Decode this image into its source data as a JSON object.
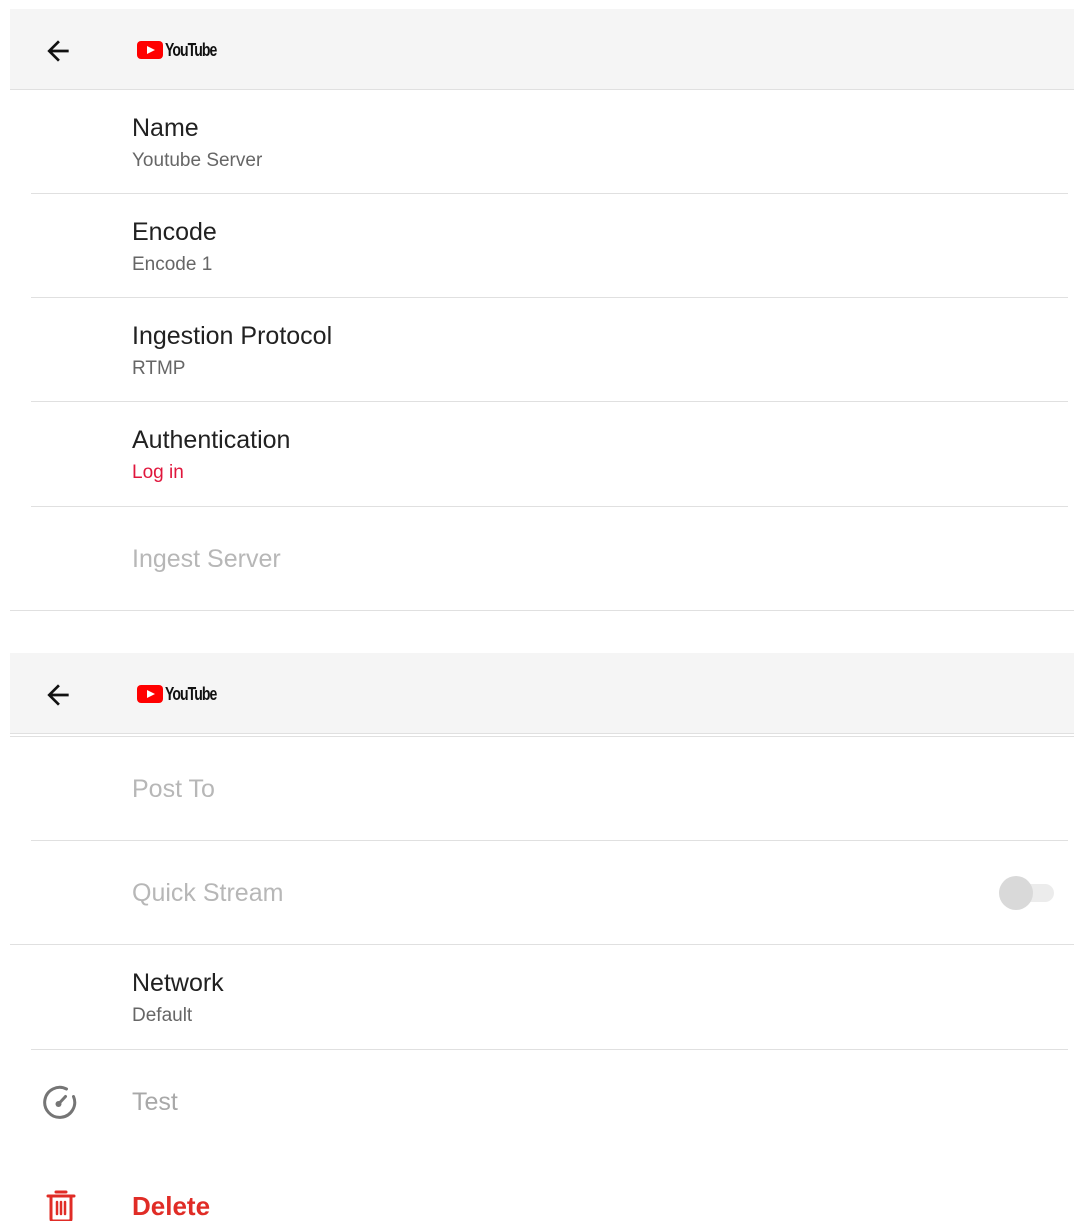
{
  "colors": {
    "accent": "#e0163c",
    "delete": "#e02c26",
    "youtube_red": "#ff0000",
    "appbar_bg": "#f5f5f5",
    "disabled_text": "#b7b7b7"
  },
  "screen1": {
    "appbar": {
      "back_icon": "arrow-left-icon",
      "logo_text": "YouTube"
    },
    "rows": [
      {
        "title": "Name",
        "value": "Youtube Server"
      },
      {
        "title": "Encode",
        "value": "Encode 1"
      },
      {
        "title": "Ingestion Protocol",
        "value": "RTMP"
      },
      {
        "title": "Authentication",
        "value": "Log in"
      },
      {
        "title": "Ingest Server"
      }
    ]
  },
  "screen2": {
    "appbar": {
      "back_icon": "arrow-left-icon",
      "logo_text": "YouTube"
    },
    "post_to": "Post To",
    "quick_stream": {
      "label": "Quick Stream",
      "enabled": false,
      "on": false
    },
    "network": {
      "title": "Network",
      "value": "Default"
    },
    "test": {
      "label": "Test",
      "icon": "speedometer-icon"
    },
    "delete": {
      "label": "Delete",
      "icon": "trash-icon"
    }
  }
}
